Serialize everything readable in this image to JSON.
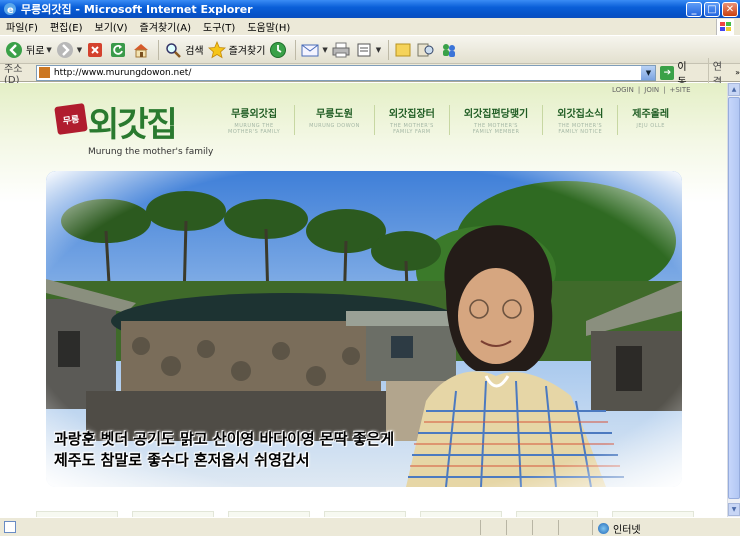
{
  "window": {
    "title": "무릉외갓집 - Microsoft Internet Explorer",
    "minimize_glyph": "_",
    "maximize_glyph": "□",
    "close_glyph": "✕"
  },
  "menu": {
    "items": [
      "파일(F)",
      "편집(E)",
      "보기(V)",
      "즐겨찾기(A)",
      "도구(T)",
      "도움말(H)"
    ]
  },
  "toolbar": {
    "back_label": "뒤로",
    "search_label": "검색",
    "favorites_label": "즐겨찾기"
  },
  "address": {
    "label": "주소(D)",
    "url": "http://www.murungdowon.net/",
    "go_label": "이동",
    "links_label": "연결",
    "more_glyph": "»"
  },
  "site": {
    "util_links": [
      "LOGIN",
      "JOIN",
      "+SITE"
    ],
    "logo": {
      "tag": "무릉",
      "brand": "외갓집",
      "subtitle": "Murung the mother's family"
    },
    "nav": [
      {
        "ko": "무릉외갓집",
        "en": "MURUNG THE\nMOTHER'S FAMILY"
      },
      {
        "ko": "무릉도원",
        "en": "MURUNG DOWON"
      },
      {
        "ko": "외갓집장터",
        "en": "THE MOTHER'S\nFAMILY FARM"
      },
      {
        "ko": "외갓집편당맺기",
        "en": "THE MOTHER'S\nFAMILY MEMBER"
      },
      {
        "ko": "외갓집소식",
        "en": "THE MOTHER'S\nFAMILY NOTICE"
      },
      {
        "ko": "제주올레",
        "en": "JEJU OLLE"
      }
    ],
    "hero_caption": [
      "과랑훈 벳더 공기도 맑고 산이영 바다이영 몬딱 좋은게",
      "제주도 참말로 좋수다 혼저옵서 쉬영갑서"
    ]
  },
  "status": {
    "zone_label": "인터넷"
  },
  "colors": {
    "titlebar": "#0a5fd8",
    "chrome": "#ece9d8",
    "nav_text": "#1f5c23",
    "logo_green": "#2a7a2f",
    "logo_tag": "#b01c2e"
  }
}
